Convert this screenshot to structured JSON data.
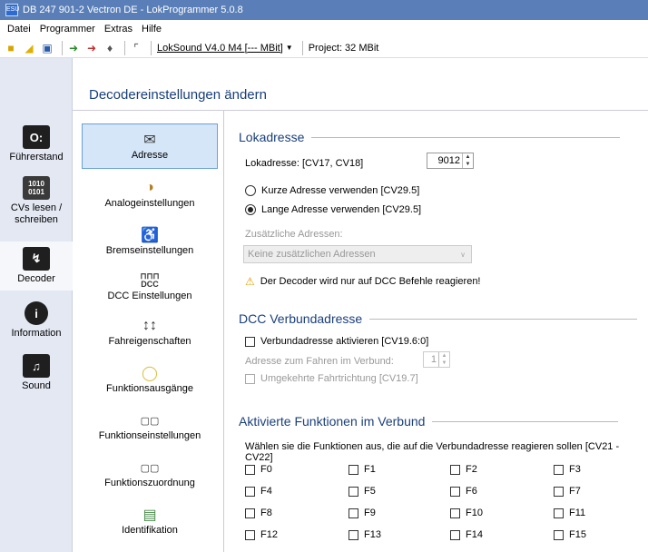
{
  "window": {
    "title": "DB 247 901-2 Vectron DE - LokProgrammer 5.0.8",
    "app_icon": "ESU"
  },
  "menu": [
    "Datei",
    "Programmer",
    "Extras",
    "Hilfe"
  ],
  "toolbar": {
    "device": "LokSound V4.0 M4 [--- MBit]",
    "project": "Project:  32 MBit"
  },
  "nav": [
    {
      "label": "Führerstand",
      "icon": "cab-icon"
    },
    {
      "label": "CVs lesen / schreiben",
      "icon": "binary-icon"
    },
    {
      "label": "Decoder",
      "icon": "wrench-icon"
    },
    {
      "label": "Information",
      "icon": "info-icon"
    },
    {
      "label": "Sound",
      "icon": "speaker-icon"
    }
  ],
  "header": {
    "title": "Decodereinstellungen ändern"
  },
  "categories": [
    "Adresse",
    "Analogeinstellungen",
    "Bremseinstellungen",
    "DCC Einstellungen",
    "Fahreigenschaften",
    "Funktionsausgänge",
    "Funktionseinstellungen",
    "Funktionszuordnung",
    "Identifikation"
  ],
  "dcc_icon_text": "DCC",
  "lokadresse": {
    "section": "Lokadresse",
    "label": "Lokadresse: [CV17, CV18]",
    "value": "9012",
    "short_radio": "Kurze Adresse verwenden [CV29.5]",
    "long_radio": "Lange Adresse verwenden [CV29.5]",
    "extra_label": "Zusätzliche Adressen:",
    "extra_value": "Keine zusätzlichen Adressen",
    "warning": "Der Decoder wird nur auf DCC Befehle reagieren!"
  },
  "verbund": {
    "section": "DCC Verbundadresse",
    "enable": "Verbundadresse aktivieren [CV19.6:0]",
    "addr_label": "Adresse zum Fahren im Verbund:",
    "addr_value": "1",
    "reverse": "Umgekehrte Fahrtrichtung [CV19.7]"
  },
  "funktionen": {
    "section": "Aktivierte Funktionen im Verbund",
    "desc": "Wählen sie die Funktionen aus, die auf die Verbundadresse reagieren sollen [CV21 - CV22]",
    "items": [
      "F0",
      "F1",
      "F2",
      "F3",
      "F4",
      "F5",
      "F6",
      "F7",
      "F8",
      "F9",
      "F10",
      "F11",
      "F12",
      "F13",
      "F14",
      "F15"
    ]
  }
}
